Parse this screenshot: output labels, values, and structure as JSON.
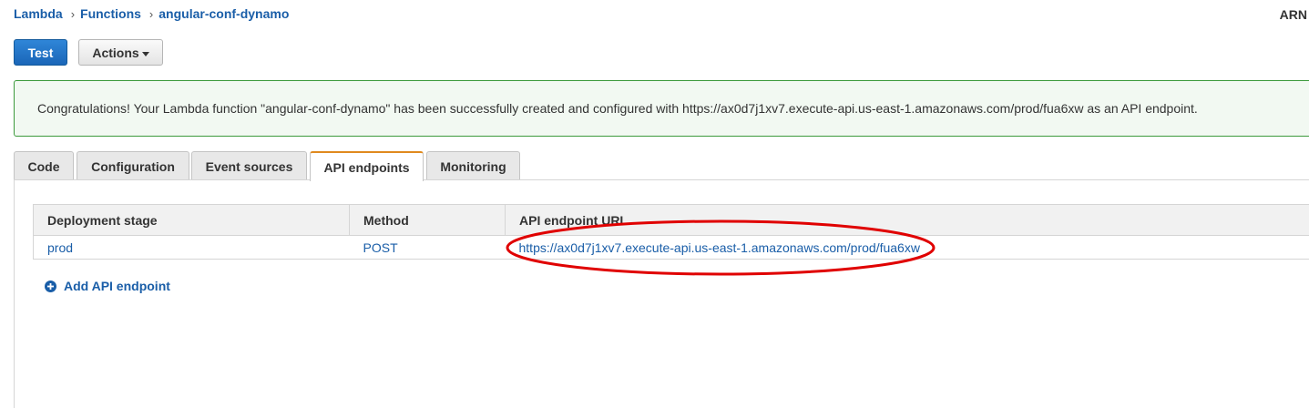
{
  "breadcrumb": {
    "items": [
      {
        "label": "Lambda"
      },
      {
        "label": "Functions"
      },
      {
        "label": "angular-conf-dynamo"
      }
    ],
    "separator": "›"
  },
  "header": {
    "arn_label": "ARN"
  },
  "toolbar": {
    "test_label": "Test",
    "actions_label": "Actions"
  },
  "alert": {
    "message": "Congratulations! Your Lambda function \"angular-conf-dynamo\" has been successfully created and configured with https://ax0d7j1xv7.execute-api.us-east-1.amazonaws.com/prod/fua6xw as an API endpoint."
  },
  "tabs": [
    {
      "label": "Code"
    },
    {
      "label": "Configuration"
    },
    {
      "label": "Event sources"
    },
    {
      "label": "API endpoints",
      "active": true
    },
    {
      "label": "Monitoring"
    }
  ],
  "table": {
    "headers": [
      "Deployment stage",
      "Method",
      "API endpoint URL"
    ],
    "rows": [
      {
        "stage": "prod",
        "method": "POST",
        "url": "https://ax0d7j1xv7.execute-api.us-east-1.amazonaws.com/prod/fua6xw"
      }
    ]
  },
  "add_endpoint": {
    "label": "Add API endpoint",
    "icon": "plus-circle-icon"
  },
  "colors": {
    "link": "#1a5ea8",
    "primary_button": "#1a66b8",
    "success_border": "#3c9a3c",
    "active_tab_accent": "#e08a1e",
    "annotation": "#e00000"
  }
}
